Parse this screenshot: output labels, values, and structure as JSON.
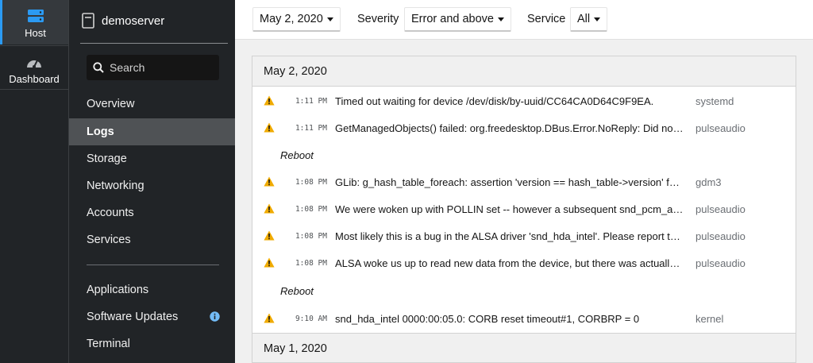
{
  "rail": {
    "host_label": "Host",
    "dashboard_label": "Dashboard"
  },
  "nav": {
    "server_name": "demoserver",
    "search_placeholder": "Search",
    "items": [
      {
        "label": "Overview"
      },
      {
        "label": "Logs"
      },
      {
        "label": "Storage"
      },
      {
        "label": "Networking"
      },
      {
        "label": "Accounts"
      },
      {
        "label": "Services"
      },
      {
        "label": "Applications"
      },
      {
        "label": "Software Updates"
      },
      {
        "label": "Terminal"
      }
    ],
    "active_item": "Logs"
  },
  "toolbar": {
    "date_value": "May 2, 2020",
    "severity_label": "Severity",
    "severity_value": "Error and above",
    "service_label": "Service",
    "service_value": "All"
  },
  "logs": {
    "day1_header": "May 2, 2020",
    "day2_header": "May 1, 2020",
    "reboot_label": "Reboot",
    "entries": [
      {
        "time": "1:11 PM",
        "message": "Timed out waiting for device /dev/disk/by-uuid/CC64CA0D64C9F9EA.",
        "service": "systemd"
      },
      {
        "time": "1:11 PM",
        "message": "GetManagedObjects() failed: org.freedesktop.DBus.Error.NoReply: Did not rece...",
        "service": "pulseaudio"
      },
      {
        "time": "1:08 PM",
        "message": "GLib: g_hash_table_foreach: assertion 'version == hash_table->version' failed",
        "service": "gdm3"
      },
      {
        "time": "1:08 PM",
        "message": "We were woken up with POLLIN set -- however a subsequent snd_pcm_avail() r...",
        "service": "pulseaudio"
      },
      {
        "time": "1:08 PM",
        "message": "Most likely this is a bug in the ALSA driver 'snd_hda_intel'. Please report this issu...",
        "service": "pulseaudio"
      },
      {
        "time": "1:08 PM",
        "message": "ALSA woke us up to read new data from the device, but there was actually nothi...",
        "service": "pulseaudio"
      },
      {
        "time": "9:10 AM",
        "message": "snd_hda_intel 0000:00:05.0: CORB reset timeout#1, CORBRP = 0",
        "service": "kernel"
      }
    ]
  },
  "colors": {
    "rail_bg": "#212427",
    "active_accent": "#2b9af3",
    "warning": "#f0ab00",
    "info": "#73bcf7"
  },
  "icons": {
    "host": "server-stack-icon",
    "dashboard": "gauge-icon",
    "server": "document-icon",
    "search": "search-icon",
    "warning": "warning-triangle-icon",
    "info": "info-circle-icon"
  }
}
